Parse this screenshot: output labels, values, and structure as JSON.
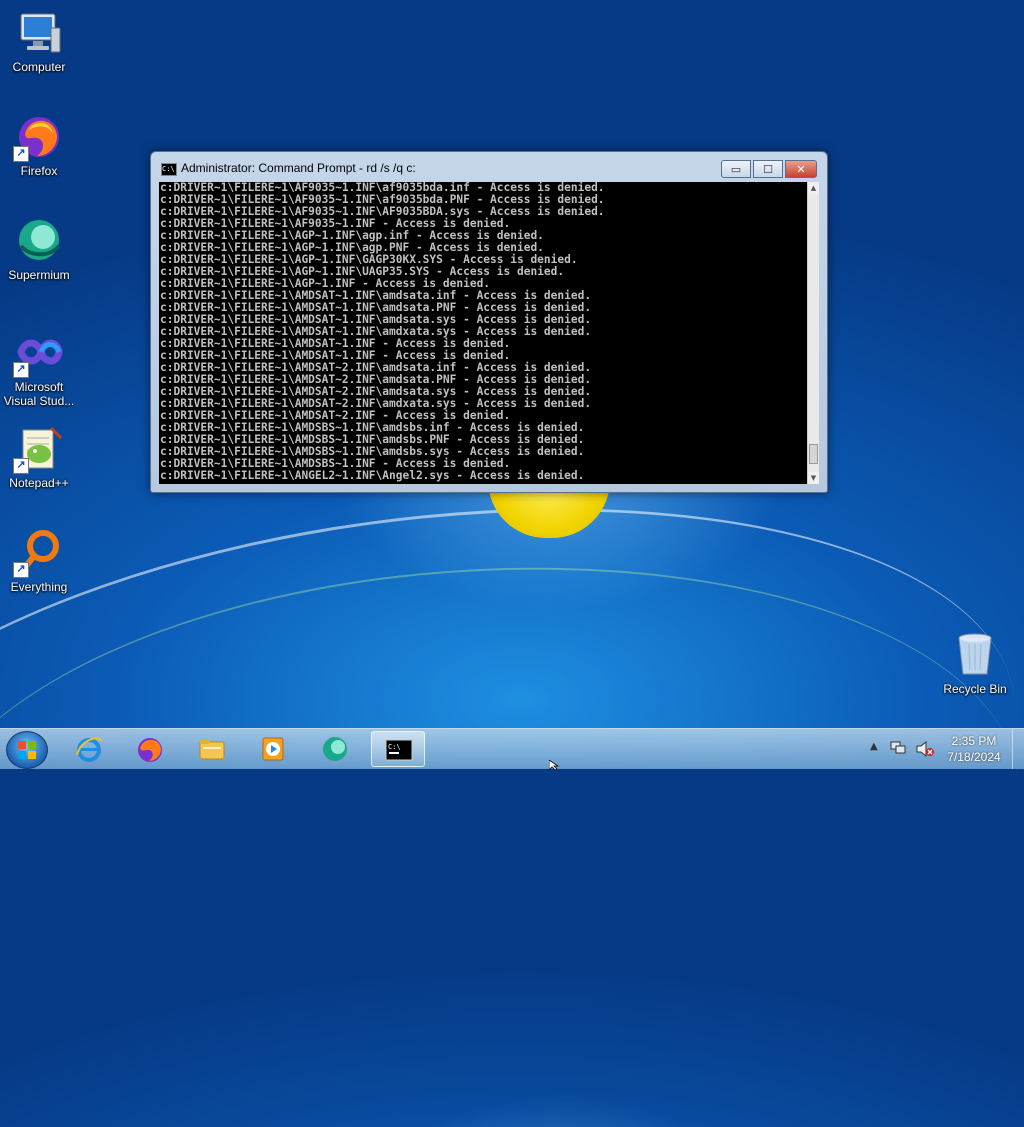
{
  "desktop": {
    "icons": [
      {
        "label": "Computer"
      },
      {
        "label": "Firefox"
      },
      {
        "label": "Supermium"
      },
      {
        "label": "Microsoft Visual Stud..."
      },
      {
        "label": "Notepad++"
      },
      {
        "label": "Everything"
      },
      {
        "label": "Recycle Bin"
      }
    ]
  },
  "window": {
    "title": "Administrator:  Command Prompt - rd  /s /q c:",
    "minimize_label": "▭",
    "maximize_label": "☐",
    "close_label": "✕",
    "console_lines": [
      "c:DRIVER~1\\FILERE~1\\AF9035~1.INF\\af9035bda.inf - Access is denied.",
      "c:DRIVER~1\\FILERE~1\\AF9035~1.INF\\af9035bda.PNF - Access is denied.",
      "c:DRIVER~1\\FILERE~1\\AF9035~1.INF\\AF9035BDA.sys - Access is denied.",
      "c:DRIVER~1\\FILERE~1\\AF9035~1.INF - Access is denied.",
      "c:DRIVER~1\\FILERE~1\\AGP~1.INF\\agp.inf - Access is denied.",
      "c:DRIVER~1\\FILERE~1\\AGP~1.INF\\agp.PNF - Access is denied.",
      "c:DRIVER~1\\FILERE~1\\AGP~1.INF\\GAGP30KX.SYS - Access is denied.",
      "c:DRIVER~1\\FILERE~1\\AGP~1.INF\\UAGP35.SYS - Access is denied.",
      "c:DRIVER~1\\FILERE~1\\AGP~1.INF - Access is denied.",
      "c:DRIVER~1\\FILERE~1\\AMDSAT~1.INF\\amdsata.inf - Access is denied.",
      "c:DRIVER~1\\FILERE~1\\AMDSAT~1.INF\\amdsata.PNF - Access is denied.",
      "c:DRIVER~1\\FILERE~1\\AMDSAT~1.INF\\amdsata.sys - Access is denied.",
      "c:DRIVER~1\\FILERE~1\\AMDSAT~1.INF\\amdxata.sys - Access is denied.",
      "c:DRIVER~1\\FILERE~1\\AMDSAT~1.INF - Access is denied.",
      "c:DRIVER~1\\FILERE~1\\AMDSAT~1.INF - Access is denied.",
      "c:DRIVER~1\\FILERE~1\\AMDSAT~2.INF\\amdsata.inf - Access is denied.",
      "c:DRIVER~1\\FILERE~1\\AMDSAT~2.INF\\amdsata.PNF - Access is denied.",
      "c:DRIVER~1\\FILERE~1\\AMDSAT~2.INF\\amdsata.sys - Access is denied.",
      "c:DRIVER~1\\FILERE~1\\AMDSAT~2.INF\\amdxata.sys - Access is denied.",
      "c:DRIVER~1\\FILERE~1\\AMDSAT~2.INF - Access is denied.",
      "c:DRIVER~1\\FILERE~1\\AMDSBS~1.INF\\amdsbs.inf - Access is denied.",
      "c:DRIVER~1\\FILERE~1\\AMDSBS~1.INF\\amdsbs.PNF - Access is denied.",
      "c:DRIVER~1\\FILERE~1\\AMDSBS~1.INF\\amdsbs.sys - Access is denied.",
      "c:DRIVER~1\\FILERE~1\\AMDSBS~1.INF - Access is denied.",
      "c:DRIVER~1\\FILERE~1\\ANGEL2~1.INF\\Angel2.sys - Access is denied."
    ]
  },
  "taskbar": {
    "pinned": [
      {
        "icon": "internet-explorer-icon"
      },
      {
        "icon": "firefox-icon"
      },
      {
        "icon": "file-explorer-icon"
      },
      {
        "icon": "media-player-icon"
      },
      {
        "icon": "supermium-icon"
      },
      {
        "icon": "command-prompt-icon",
        "active": true
      }
    ],
    "tray": {
      "time": "2:35 PM",
      "date": "7/18/2024"
    }
  },
  "colors": {
    "console_bg": "#000000",
    "console_text": "#c0c0c0",
    "desktop_blue": "#0b5bb6"
  }
}
